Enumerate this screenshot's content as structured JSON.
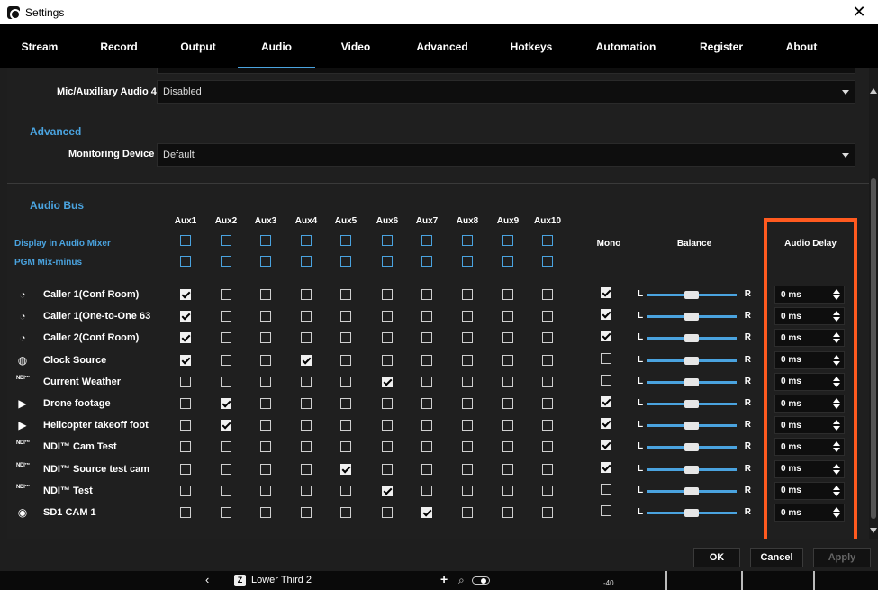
{
  "window": {
    "title": "Settings",
    "close_glyph": "✕"
  },
  "tabs": [
    "Stream",
    "Record",
    "Output",
    "Audio",
    "Video",
    "Advanced",
    "Hotkeys",
    "Automation",
    "Register",
    "About"
  ],
  "active_tab": "Audio",
  "mic_aux4": {
    "label": "Mic/Auxiliary Audio 4",
    "value": "Disabled"
  },
  "advanced": {
    "heading": "Advanced",
    "monitoring_label": "Monitoring Device",
    "monitoring_value": "Default"
  },
  "audio_bus": {
    "heading": "Audio Bus",
    "aux_headers": [
      "Aux1",
      "Aux2",
      "Aux3",
      "Aux4",
      "Aux5",
      "Aux6",
      "Aux7",
      "Aux8",
      "Aux9",
      "Aux10"
    ],
    "display_label": "Display in Audio Mixer",
    "pgm_label": "PGM Mix-minus",
    "mono_header": "Mono",
    "balance_header": "Balance",
    "delay_header": "Audio Delay",
    "balance_left": "L",
    "balance_right": "R",
    "rows": [
      {
        "name": "Caller 1(Conf Room)",
        "icon": "caller-icon",
        "aux": [
          1,
          0,
          0,
          0,
          0,
          0,
          0,
          0,
          0,
          0
        ],
        "mono": 1,
        "delay": "0 ms"
      },
      {
        "name": "Caller 1(One-to-One 63",
        "icon": "caller-icon",
        "aux": [
          1,
          0,
          0,
          0,
          0,
          0,
          0,
          0,
          0,
          0
        ],
        "mono": 1,
        "delay": "0 ms"
      },
      {
        "name": "Caller 2(Conf Room)",
        "icon": "caller-icon",
        "aux": [
          1,
          0,
          0,
          0,
          0,
          0,
          0,
          0,
          0,
          0
        ],
        "mono": 1,
        "delay": "0 ms"
      },
      {
        "name": "Clock Source",
        "icon": "globe-icon",
        "aux": [
          1,
          0,
          0,
          1,
          0,
          0,
          0,
          0,
          0,
          0
        ],
        "mono": 0,
        "delay": "0 ms"
      },
      {
        "name": "Current Weather",
        "icon": "ndi-icon",
        "aux": [
          0,
          0,
          0,
          0,
          0,
          1,
          0,
          0,
          0,
          0
        ],
        "mono": 0,
        "delay": "0 ms"
      },
      {
        "name": "Drone footage",
        "icon": "play-icon",
        "aux": [
          0,
          1,
          0,
          0,
          0,
          0,
          0,
          0,
          0,
          0
        ],
        "mono": 1,
        "delay": "0 ms"
      },
      {
        "name": "Helicopter takeoff foot",
        "icon": "play-icon",
        "aux": [
          0,
          1,
          0,
          0,
          0,
          0,
          0,
          0,
          0,
          0
        ],
        "mono": 1,
        "delay": "0 ms"
      },
      {
        "name": "NDI™ Cam Test",
        "icon": "ndi-icon",
        "aux": [
          0,
          0,
          0,
          0,
          0,
          0,
          0,
          0,
          0,
          0
        ],
        "mono": 1,
        "delay": "0 ms"
      },
      {
        "name": "NDI™ Source test cam",
        "icon": "ndi-icon",
        "aux": [
          0,
          0,
          0,
          0,
          1,
          0,
          0,
          0,
          0,
          0
        ],
        "mono": 1,
        "delay": "0 ms"
      },
      {
        "name": "NDI™ Test",
        "icon": "ndi-icon",
        "aux": [
          0,
          0,
          0,
          0,
          0,
          1,
          0,
          0,
          0,
          0
        ],
        "mono": 0,
        "delay": "0 ms"
      },
      {
        "name": "SD1 CAM 1",
        "icon": "eye-icon",
        "aux": [
          0,
          0,
          0,
          0,
          0,
          0,
          1,
          0,
          0,
          0
        ],
        "mono": 0,
        "delay": "0 ms"
      }
    ]
  },
  "buttons": {
    "ok": "OK",
    "cancel": "Cancel",
    "apply": "Apply"
  },
  "bottom_bar": {
    "source_label": "Lower Third 2",
    "source_key": "Z",
    "meter_label": "-40"
  },
  "colors": {
    "accent": "#4aa3df",
    "highlight": "#ff5a1f"
  }
}
